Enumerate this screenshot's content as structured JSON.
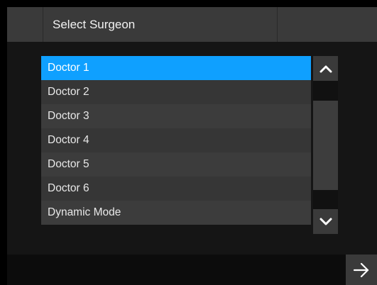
{
  "header": {
    "title": "Select Surgeon"
  },
  "surgeon_list": {
    "items": [
      {
        "label": "Doctor 1",
        "selected": true
      },
      {
        "label": "Doctor 2",
        "selected": false
      },
      {
        "label": "Doctor 3",
        "selected": false
      },
      {
        "label": "Doctor 4",
        "selected": false
      },
      {
        "label": "Doctor 5",
        "selected": false
      },
      {
        "label": "Doctor 6",
        "selected": false
      },
      {
        "label": "Dynamic Mode",
        "selected": false
      }
    ]
  },
  "scrollbar": {
    "up_icon": "chevron-up-icon",
    "down_icon": "chevron-down-icon"
  },
  "footer": {
    "next_icon": "arrow-right-icon"
  },
  "colors": {
    "accent": "#0fa0ff",
    "background": "#000000",
    "panel": "#3a3a3a"
  }
}
